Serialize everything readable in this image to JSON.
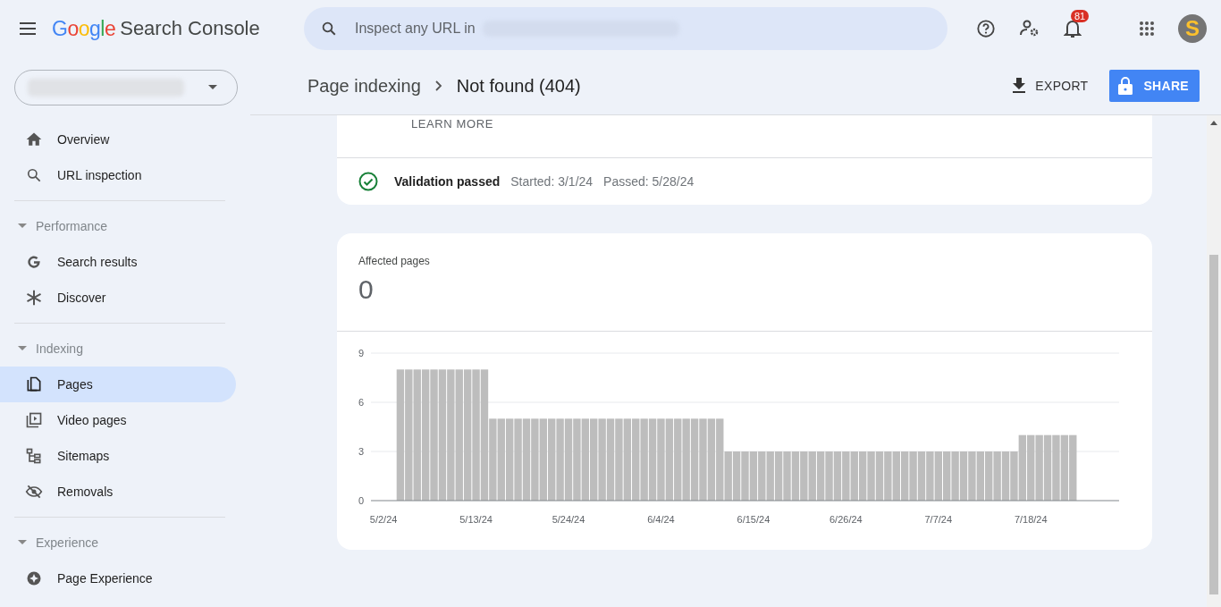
{
  "header": {
    "product": {
      "brand": "Google",
      "name": "Search Console"
    },
    "search": {
      "placeholder": "Inspect any URL in"
    },
    "notifications": {
      "count": "81"
    },
    "avatar": {
      "letter": "S"
    }
  },
  "sidebar": {
    "property_selector": {
      "expanded": false
    },
    "sections": [
      {
        "items": [
          {
            "label": "Overview",
            "selected": false
          },
          {
            "label": "URL inspection",
            "selected": false
          }
        ]
      },
      {
        "title": "Performance",
        "expanded": true,
        "items": [
          {
            "label": "Search results",
            "selected": false
          },
          {
            "label": "Discover",
            "selected": false
          }
        ]
      },
      {
        "title": "Indexing",
        "expanded": true,
        "items": [
          {
            "label": "Pages",
            "selected": true
          },
          {
            "label": "Video pages",
            "selected": false
          },
          {
            "label": "Sitemaps",
            "selected": false
          },
          {
            "label": "Removals",
            "selected": false
          }
        ]
      },
      {
        "title": "Experience",
        "expanded": true,
        "items": [
          {
            "label": "Page Experience",
            "selected": false
          }
        ]
      }
    ]
  },
  "page_header": {
    "breadcrumb": [
      "Page indexing",
      "Not found (404)"
    ],
    "export": "EXPORT",
    "share": "SHARE"
  },
  "validation_card": {
    "link": "LEARN MORE",
    "status": "Validation passed",
    "passed": true,
    "started": "Started: 3/1/24",
    "passed_on": "Passed: 5/28/24"
  },
  "affected_card": {
    "label": "Affected pages",
    "value": "0",
    "chart_data": {
      "type": "bar",
      "categories": [
        null,
        "5/2/24",
        null,
        null,
        null,
        null,
        null,
        null,
        null,
        null,
        null,
        null,
        "5/13/24",
        null,
        null,
        null,
        null,
        null,
        null,
        null,
        null,
        null,
        null,
        "5/24/24",
        null,
        null,
        null,
        null,
        null,
        null,
        null,
        null,
        null,
        null,
        "6/4/24",
        null,
        null,
        null,
        null,
        null,
        null,
        null,
        null,
        null,
        null,
        "6/15/24",
        null,
        null,
        null,
        null,
        null,
        null,
        null,
        null,
        null,
        null,
        "6/26/24",
        null,
        null,
        null,
        null,
        null,
        null,
        null,
        null,
        null,
        null,
        "7/7/24",
        null,
        null,
        null,
        null,
        null,
        null,
        null,
        null,
        null,
        null,
        "7/18/24",
        null,
        null,
        null,
        null,
        null,
        null,
        null,
        null,
        null,
        null
      ],
      "values": [
        null,
        null,
        null,
        8,
        8,
        8,
        8,
        8,
        8,
        8,
        8,
        8,
        8,
        8,
        5,
        5,
        5,
        5,
        5,
        5,
        5,
        5,
        5,
        5,
        5,
        5,
        5,
        5,
        5,
        5,
        5,
        5,
        5,
        5,
        5,
        5,
        5,
        5,
        5,
        5,
        5,
        5,
        3,
        3,
        3,
        3,
        3,
        3,
        3,
        3,
        3,
        3,
        3,
        3,
        3,
        3,
        3,
        3,
        3,
        3,
        3,
        3,
        3,
        3,
        3,
        3,
        3,
        3,
        3,
        3,
        3,
        3,
        3,
        3,
        3,
        3,
        3,
        4,
        4,
        4,
        4,
        4,
        4,
        4,
        null,
        null,
        null,
        null,
        null
      ],
      "ylim": [
        0,
        9
      ],
      "yticks": [
        0,
        3,
        6,
        9
      ]
    }
  }
}
